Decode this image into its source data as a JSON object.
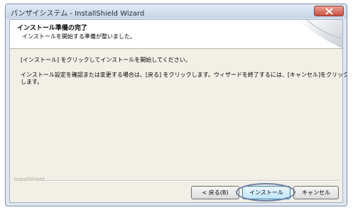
{
  "window": {
    "title": "パンザイシステム - InstallShield Wizard"
  },
  "header": {
    "title": "インストール準備の完了",
    "subtitle": "インストールを開始する準備が整いました。"
  },
  "body": {
    "line1": "[インストール] をクリックしてインストールを開始してください。",
    "line2": "インストール設定を確認または変更する場合は、[戻る] をクリックします。ウィザードを終了するには、[キャンセル]をクリック",
    "line3": "します。"
  },
  "footer": {
    "brand": "InstallShield"
  },
  "buttons": {
    "back": "< 戻る(B)",
    "install": "インストール",
    "cancel": "キャンセル"
  },
  "icons": {
    "close": "close-icon",
    "header_graphic": "wizard-swoosh-graphic"
  },
  "colors": {
    "highlight": "#6d7e9e",
    "close_button": "#c8513f"
  }
}
